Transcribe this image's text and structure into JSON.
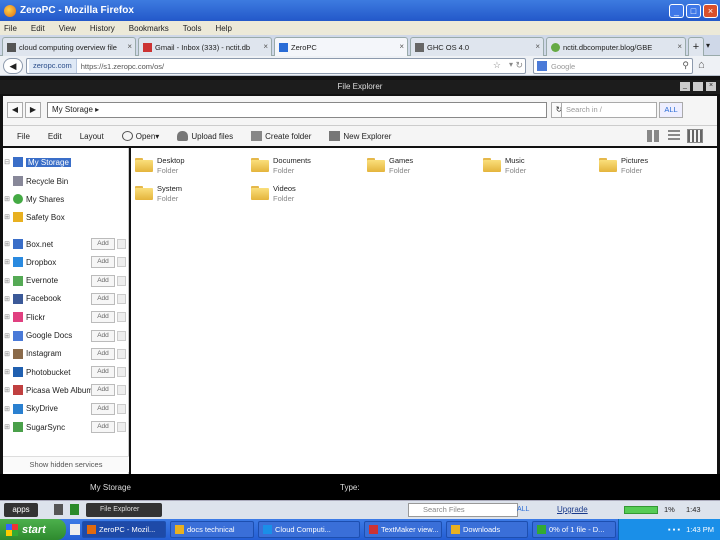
{
  "window": {
    "title": "ZeroPC - Mozilla Firefox"
  },
  "menu": [
    "File",
    "Edit",
    "View",
    "History",
    "Bookmarks",
    "Tools",
    "Help"
  ],
  "tabs": [
    {
      "label": "cloud computing overview file",
      "color": "#555"
    },
    {
      "label": "Gmail - Inbox (333) - nctit.db",
      "color": "#c33"
    },
    {
      "label": "ZeroPC",
      "color": "#2a6cd6"
    },
    {
      "label": "GHC OS 4.0",
      "color": "#666"
    },
    {
      "label": "nctit.dbcomputer.blog/GBE",
      "color": "#6a4"
    }
  ],
  "nav": {
    "site": "zeropc.com",
    "url": "https://s1.zeropc.com/os/",
    "search_placeholder": "Google"
  },
  "app": {
    "title": "File Explorer",
    "path": "My Storage",
    "search_placeholder": "Search in /",
    "search_scope": "ALL",
    "toolbar": {
      "file": "File",
      "edit": "Edit",
      "layout": "Layout",
      "open": "Open",
      "upload": "Upload files",
      "create": "Create folder",
      "new_explorer": "New Explorer"
    }
  },
  "sidebar": {
    "items": [
      {
        "label": "My Storage",
        "selected": true,
        "icon": "storage-icon",
        "color": "#3a6ec8"
      },
      {
        "label": "Recycle Bin",
        "icon": "recycle-bin-icon",
        "color": "#889"
      },
      {
        "label": "My Shares",
        "icon": "shares-icon",
        "color": "#4a4"
      },
      {
        "label": "Safety Box",
        "icon": "lock-icon",
        "color": "#e8b020"
      }
    ],
    "services": [
      {
        "label": "Box.net",
        "add": "Add",
        "color": "#3a6ec8"
      },
      {
        "label": "Dropbox",
        "add": "Add",
        "color": "#2a8ae0"
      },
      {
        "label": "Evernote",
        "add": "Add",
        "color": "#5a5"
      },
      {
        "label": "Facebook",
        "add": "Add",
        "color": "#3b5998"
      },
      {
        "label": "Flickr",
        "add": "Add",
        "color": "#e04080"
      },
      {
        "label": "Google Docs",
        "add": "Add",
        "color": "#4a7ad8"
      },
      {
        "label": "Instagram",
        "add": "Add",
        "color": "#8a6a4a"
      },
      {
        "label": "Photobucket",
        "add": "Add",
        "color": "#2060b0"
      },
      {
        "label": "Picasa Web Album",
        "add": "Add",
        "color": "#c04040"
      },
      {
        "label": "SkyDrive",
        "add": "Add",
        "color": "#2a80d0"
      },
      {
        "label": "SugarSync",
        "add": "Add",
        "color": "#4aa04a"
      }
    ],
    "show_hidden": "Show hidden services"
  },
  "files": [
    {
      "name": "Desktop",
      "type": "Folder"
    },
    {
      "name": "Documents",
      "type": "Folder"
    },
    {
      "name": "Games",
      "type": "Folder"
    },
    {
      "name": "Music",
      "type": "Folder"
    },
    {
      "name": "Pictures",
      "type": "Folder"
    },
    {
      "name": "System",
      "type": "Folder"
    },
    {
      "name": "Videos",
      "type": "Folder"
    }
  ],
  "status": {
    "location": "My Storage",
    "type_label": "Type:"
  },
  "addon": {
    "apps": "apps",
    "task": "File Explorer",
    "search_placeholder": "Search Files",
    "scope": "ALL",
    "upgrade": "Upgrade",
    "storage": "1%",
    "time": "1:43"
  },
  "taskbar": {
    "start": "start",
    "tasks": [
      "ZeroPC - Mozil...",
      "docs technical",
      "Cloud Computi...",
      "TextMaker view...",
      "Downloads",
      "0% of 1 file - D..."
    ],
    "clock": "1:43 PM"
  }
}
